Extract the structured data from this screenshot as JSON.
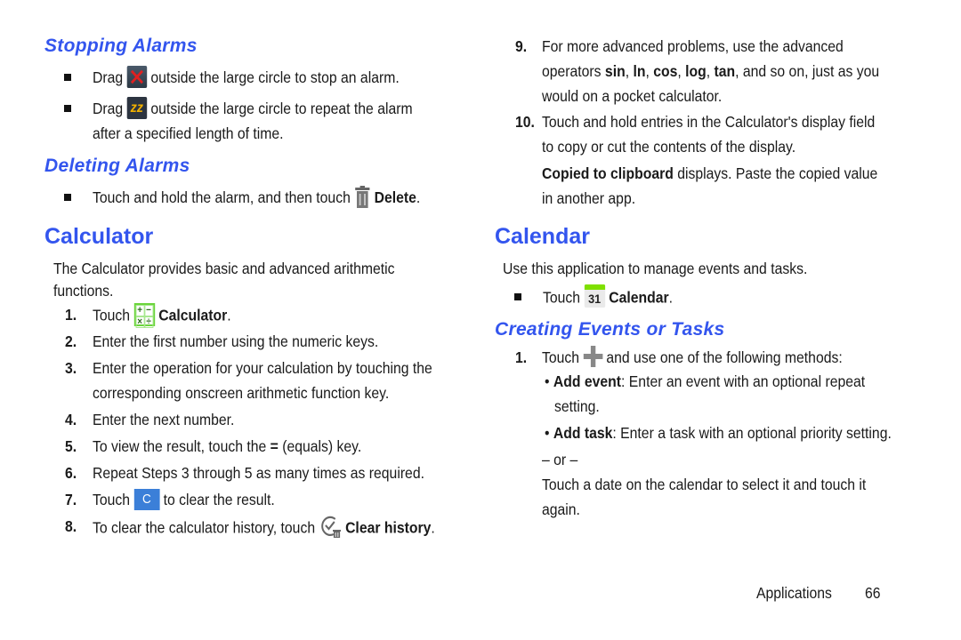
{
  "left": {
    "stopping": {
      "heading": "Stopping Alarms",
      "items": [
        {
          "pre": "Drag",
          "icon": "dismiss-x-icon",
          "post": "outside the large circle to stop an alarm."
        },
        {
          "pre": "Drag",
          "icon": "snooze-zz-icon",
          "post": "outside the large circle to repeat the alarm",
          "cont": "after a specified length of time."
        }
      ]
    },
    "deleting": {
      "heading": "Deleting Alarms",
      "item": {
        "pre": "Touch and hold the alarm, and then touch",
        "icon": "trash-icon",
        "bold": "Delete",
        "post": "."
      }
    },
    "calculator": {
      "heading": "Calculator",
      "intro1": "The Calculator provides basic and advanced arithmetic",
      "intro2": "functions.",
      "steps": [
        {
          "n": "1.",
          "pre": "Touch",
          "icon": "calculator-icon",
          "bold": "Calculator",
          "post": "."
        },
        {
          "n": "2.",
          "text": "Enter the first number using the numeric keys."
        },
        {
          "n": "3.",
          "text": "Enter the operation for your calculation by touching the",
          "cont": "corresponding onscreen arithmetic function key."
        },
        {
          "n": "4.",
          "text": "Enter the next number."
        },
        {
          "n": "5.",
          "pre": "To view the result, touch the",
          "bold": "=",
          "post": "(equals) key."
        },
        {
          "n": "6.",
          "text": "Repeat Steps 3 through 5 as many times as required."
        },
        {
          "n": "7.",
          "pre": "Touch",
          "icon": "clear-c-icon",
          "icon_label": "C",
          "post": "to clear the result."
        },
        {
          "n": "8.",
          "pre": "To clear the calculator history, touch",
          "icon": "clear-history-icon",
          "bold": "Clear history",
          "post": "."
        }
      ]
    }
  },
  "right": {
    "steps": [
      {
        "n": "9.",
        "l1": "For more advanced problems, use the advanced",
        "l2_pre": "operators",
        "ops": [
          "sin",
          "ln",
          "cos",
          "log",
          "tan"
        ],
        "l2_post": ", and so on, just as you",
        "l3": "would on a pocket calculator."
      },
      {
        "n": "10.",
        "l1": "Touch and hold entries in the Calculator's display field",
        "l2": "to copy or cut the contents of the display.",
        "l3_bold": "Copied to clipboard",
        "l3_post": "displays. Paste the copied value",
        "l4": "in another app."
      }
    ],
    "calendar": {
      "heading": "Calendar",
      "intro": "Use this application to manage events and tasks.",
      "item": {
        "pre": "Touch",
        "icon": "calendar-icon",
        "icon_label": "31",
        "bold": "Calendar",
        "post": "."
      },
      "sub_heading": "Creating Events or Tasks",
      "step1": {
        "n": "1.",
        "pre": "Touch",
        "icon": "plus-icon",
        "post": "and use one of the following methods:"
      },
      "bullets": [
        {
          "bold": "Add event",
          "text": ": Enter an event with an optional repeat",
          "cont": "setting."
        },
        {
          "bold": "Add task",
          "text": ": Enter a task with an optional priority setting."
        }
      ],
      "or": "– or –",
      "alt1": "Touch a date on the calendar to select it and touch it",
      "alt2": "again."
    }
  },
  "footer": {
    "section": "Applications",
    "page": "66"
  },
  "colors": {
    "heading": "#3355ee",
    "text": "#1a1a1a",
    "calc_icon": "#6ad43a",
    "clear_button": "#3b7fd8",
    "calendar_bar": "#7fe000"
  }
}
